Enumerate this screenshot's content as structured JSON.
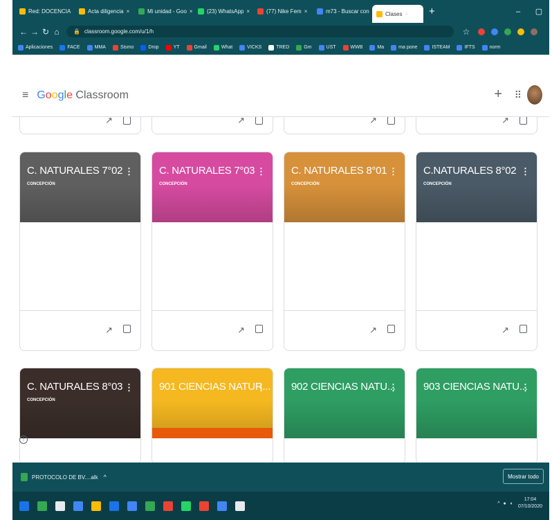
{
  "browser": {
    "tabs": [
      {
        "label": "Red: DOCENCIA",
        "color": "#fbbc05",
        "active": false
      },
      {
        "label": "Acta diligencia",
        "color": "#fbbc05",
        "active": false
      },
      {
        "label": "Mi unidad - Goo",
        "color": "#34a853",
        "active": false
      },
      {
        "label": "(23) WhatsApp",
        "color": "#25d366",
        "active": false
      },
      {
        "label": "(77) Nike Fem",
        "color": "#ea4335",
        "active": false
      },
      {
        "label": "m73 - Buscar con",
        "color": "#4285f4",
        "active": false
      },
      {
        "label": "Clases",
        "color": "#fbbc05",
        "active": true
      }
    ],
    "new_tab": "+",
    "minimize": "–",
    "url": "classroom.google.com/u/1/h",
    "bookmarks": [
      {
        "label": "Aplicaciones",
        "color": "#4285f4"
      },
      {
        "label": "FACE",
        "color": "#1877f2"
      },
      {
        "label": "MMA",
        "color": "#4285f4"
      },
      {
        "label": "Sismo",
        "color": "#ea4335"
      },
      {
        "label": "Drop",
        "color": "#0061ff"
      },
      {
        "label": "YT",
        "color": "#ff0000"
      },
      {
        "label": "Gmail",
        "color": "#ea4335"
      },
      {
        "label": "What",
        "color": "#25d366"
      },
      {
        "label": "VICKS",
        "color": "#4285f4"
      },
      {
        "label": "TRED",
        "color": "#ffffff"
      },
      {
        "label": "Gm",
        "color": "#34a853"
      },
      {
        "label": "UST",
        "color": "#4285f4"
      },
      {
        "label": "WWB",
        "color": "#ea4335"
      },
      {
        "label": "Ma",
        "color": "#4285f4"
      },
      {
        "label": "ma pone",
        "color": "#4285f4"
      },
      {
        "label": "ISTEAM",
        "color": "#4285f4"
      },
      {
        "label": "IFTS",
        "color": "#4285f4"
      },
      {
        "label": "norm",
        "color": "#4285f4"
      }
    ]
  },
  "app": {
    "logo_google": [
      "G",
      "o",
      "o",
      "g",
      "l",
      "e"
    ],
    "logo_product": " Classroom",
    "add_icon": "+",
    "apps_icon": "⠿"
  },
  "cards": [
    {
      "title": "C. NATURALES 7°02",
      "subtitle": "CONCEPCIÓN",
      "color": "#5f5f5f",
      "row": 0,
      "col": 0
    },
    {
      "title": "C. NATURALES 7°03",
      "subtitle": "CONCEPCIÓN",
      "color": "#d64ba0",
      "row": 0,
      "col": 1
    },
    {
      "title": "C. NATURALES 8°01",
      "subtitle": "CONCEPCIÓN",
      "color": "#d7913a",
      "row": 0,
      "col": 2
    },
    {
      "title": "C.NATURALES 8°02",
      "subtitle": "CONCEPCIÓN",
      "color": "#4a5a66",
      "row": 0,
      "col": 3
    },
    {
      "title": "C. NATURALES 8°03",
      "subtitle": "CONCEPCIÓN",
      "color": "#3b2e2a",
      "row": 1,
      "col": 0
    },
    {
      "title": "901 CIENCIAS NATUR...",
      "subtitle": "",
      "color": "#f5b820",
      "row": 1,
      "col": 1
    },
    {
      "title": "902 CIENCIAS NATU...",
      "subtitle": "",
      "color": "#2e9e63",
      "row": 1,
      "col": 2
    },
    {
      "title": "903 CIENCIAS NATU...",
      "subtitle": "",
      "color": "#2e9e63",
      "row": 1,
      "col": 3
    }
  ],
  "card_menu_icon": "⋮",
  "card_trend_icon": "↗",
  "download": {
    "filename": "PROTOCOLO DE BV....alk",
    "chevron": "^",
    "show_all": "Mostrar todo"
  },
  "os": {
    "taskbar_icons": [
      "#1a73e8",
      "#34a853",
      "#e8eaed",
      "#4285f4",
      "#fbbc05",
      "#1a73e8",
      "#4285f4",
      "#34a853",
      "#ea4335",
      "#25d366",
      "#ea4335",
      "#4285f4",
      "#e8eaed"
    ],
    "time": "17:04",
    "date": "07/10/2020"
  }
}
